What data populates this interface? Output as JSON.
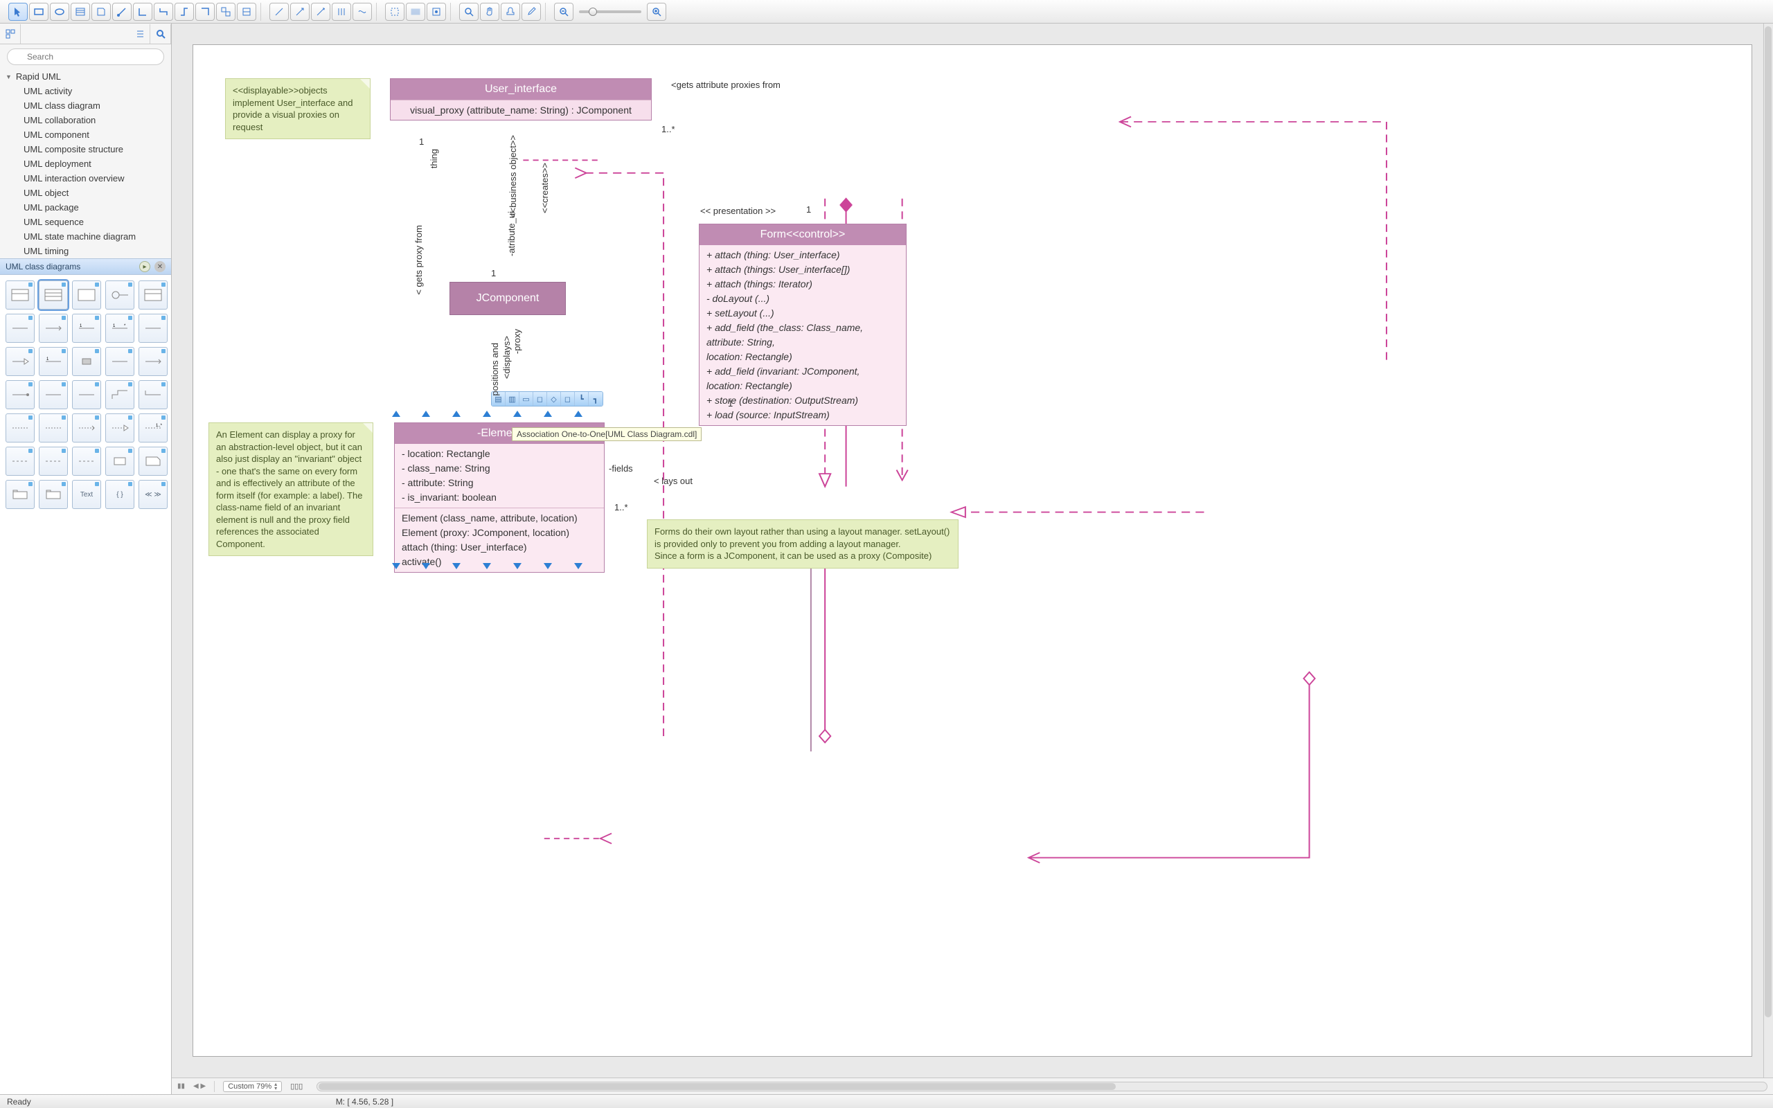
{
  "toolbar_icons": [
    "pointer",
    "rect",
    "ellipse",
    "table",
    "note",
    "connector",
    "ortho1",
    "ortho2",
    "ortho3",
    "ortho4",
    "group1",
    "group2",
    "line1",
    "line2",
    "line3",
    "line4",
    "line5",
    "region1",
    "region2",
    "region3",
    "zoom-in",
    "hand",
    "stamp",
    "eyedrop"
  ],
  "sidebar": {
    "search_placeholder": "Search",
    "tree_root": "Rapid UML",
    "tree_items": [
      "UML activity",
      "UML class diagram",
      "UML collaboration",
      "UML component",
      "UML composite structure",
      "UML deployment",
      "UML interaction overview",
      "UML object",
      "UML package",
      "UML sequence",
      "UML state machine diagram",
      "UML timing"
    ],
    "palette_title": "UML class diagrams",
    "palette_text": "Text"
  },
  "canvas": {
    "note_displayable": "<<displayable>>objects implement User_interface and provide a visual proxies on request",
    "note_element": "An Element can display a proxy for an abstraction-level object, but it can also just display an \"invariant\" object - one that's the same on every form and is effectively an attribute of the form itself (for example: a label). The class-name field of an invariant element is null and the proxy field references the associated Component.",
    "note_form": "Forms do their own layout rather than using a layout manager. setLayout() is provided only to prevent you from adding a layout manager.\nSince a form is a JComponent, it can be used as a proxy (Composite)",
    "user_interface": {
      "title": "User_interface",
      "op": "visual_proxy (attribute_name: String) : JComponent"
    },
    "jcomponent": "JComponent",
    "form": {
      "title": "Form<<control>>",
      "ops": [
        "+ attach (thing: User_interface)",
        "+ attach (things: User_interface[])",
        "+ attach (things: Iterator)",
        "- doLayout (...)",
        "+ setLayout (...)",
        "+ add_field (the_class: Class_name,",
        "                  attribute: String,",
        "                  location: Rectangle)",
        "+ add_field (invariant: JComponent,",
        "                  location: Rectangle)",
        "+ store (destination: OutputStream)",
        "+ load (source: InputStream)"
      ]
    },
    "element": {
      "title": "-Element",
      "attrs": [
        "- location: Rectangle",
        "- class_name: String",
        "- attribute: String",
        "- is_invariant: boolean"
      ],
      "ops": [
        "Element (class_name, attribute, location)",
        "Element (proxy: JComponent, location)",
        "attach (thing: User_interface)",
        "activate()"
      ]
    },
    "labels": {
      "gets_proxies": "<gets attribute proxies from",
      "one_star_top": "1..*",
      "presentation": "<< presentation >>",
      "one_top": "1",
      "gets_proxy_from": "< gets proxy from",
      "thing": "thing",
      "one_thing": "1",
      "business": "<<business object>>",
      "atribute_ui": "-atribute_ui",
      "one_mid": "1",
      "creates": "<<creates>>",
      "displays": "<displays>",
      "proxy": "-proxy",
      "positions": "positions and",
      "one_form": "1",
      "fields": "-fields",
      "lays_out": "< lays out",
      "one_star_bot": "1..*"
    },
    "toolstrip_tooltip": "Association One-to-One[UML Class Diagram.cdl]"
  },
  "ruler": {
    "zoom": "Custom 79%"
  },
  "status": {
    "ready": "Ready",
    "coords": "M: [ 4.56, 5.28 ]"
  }
}
